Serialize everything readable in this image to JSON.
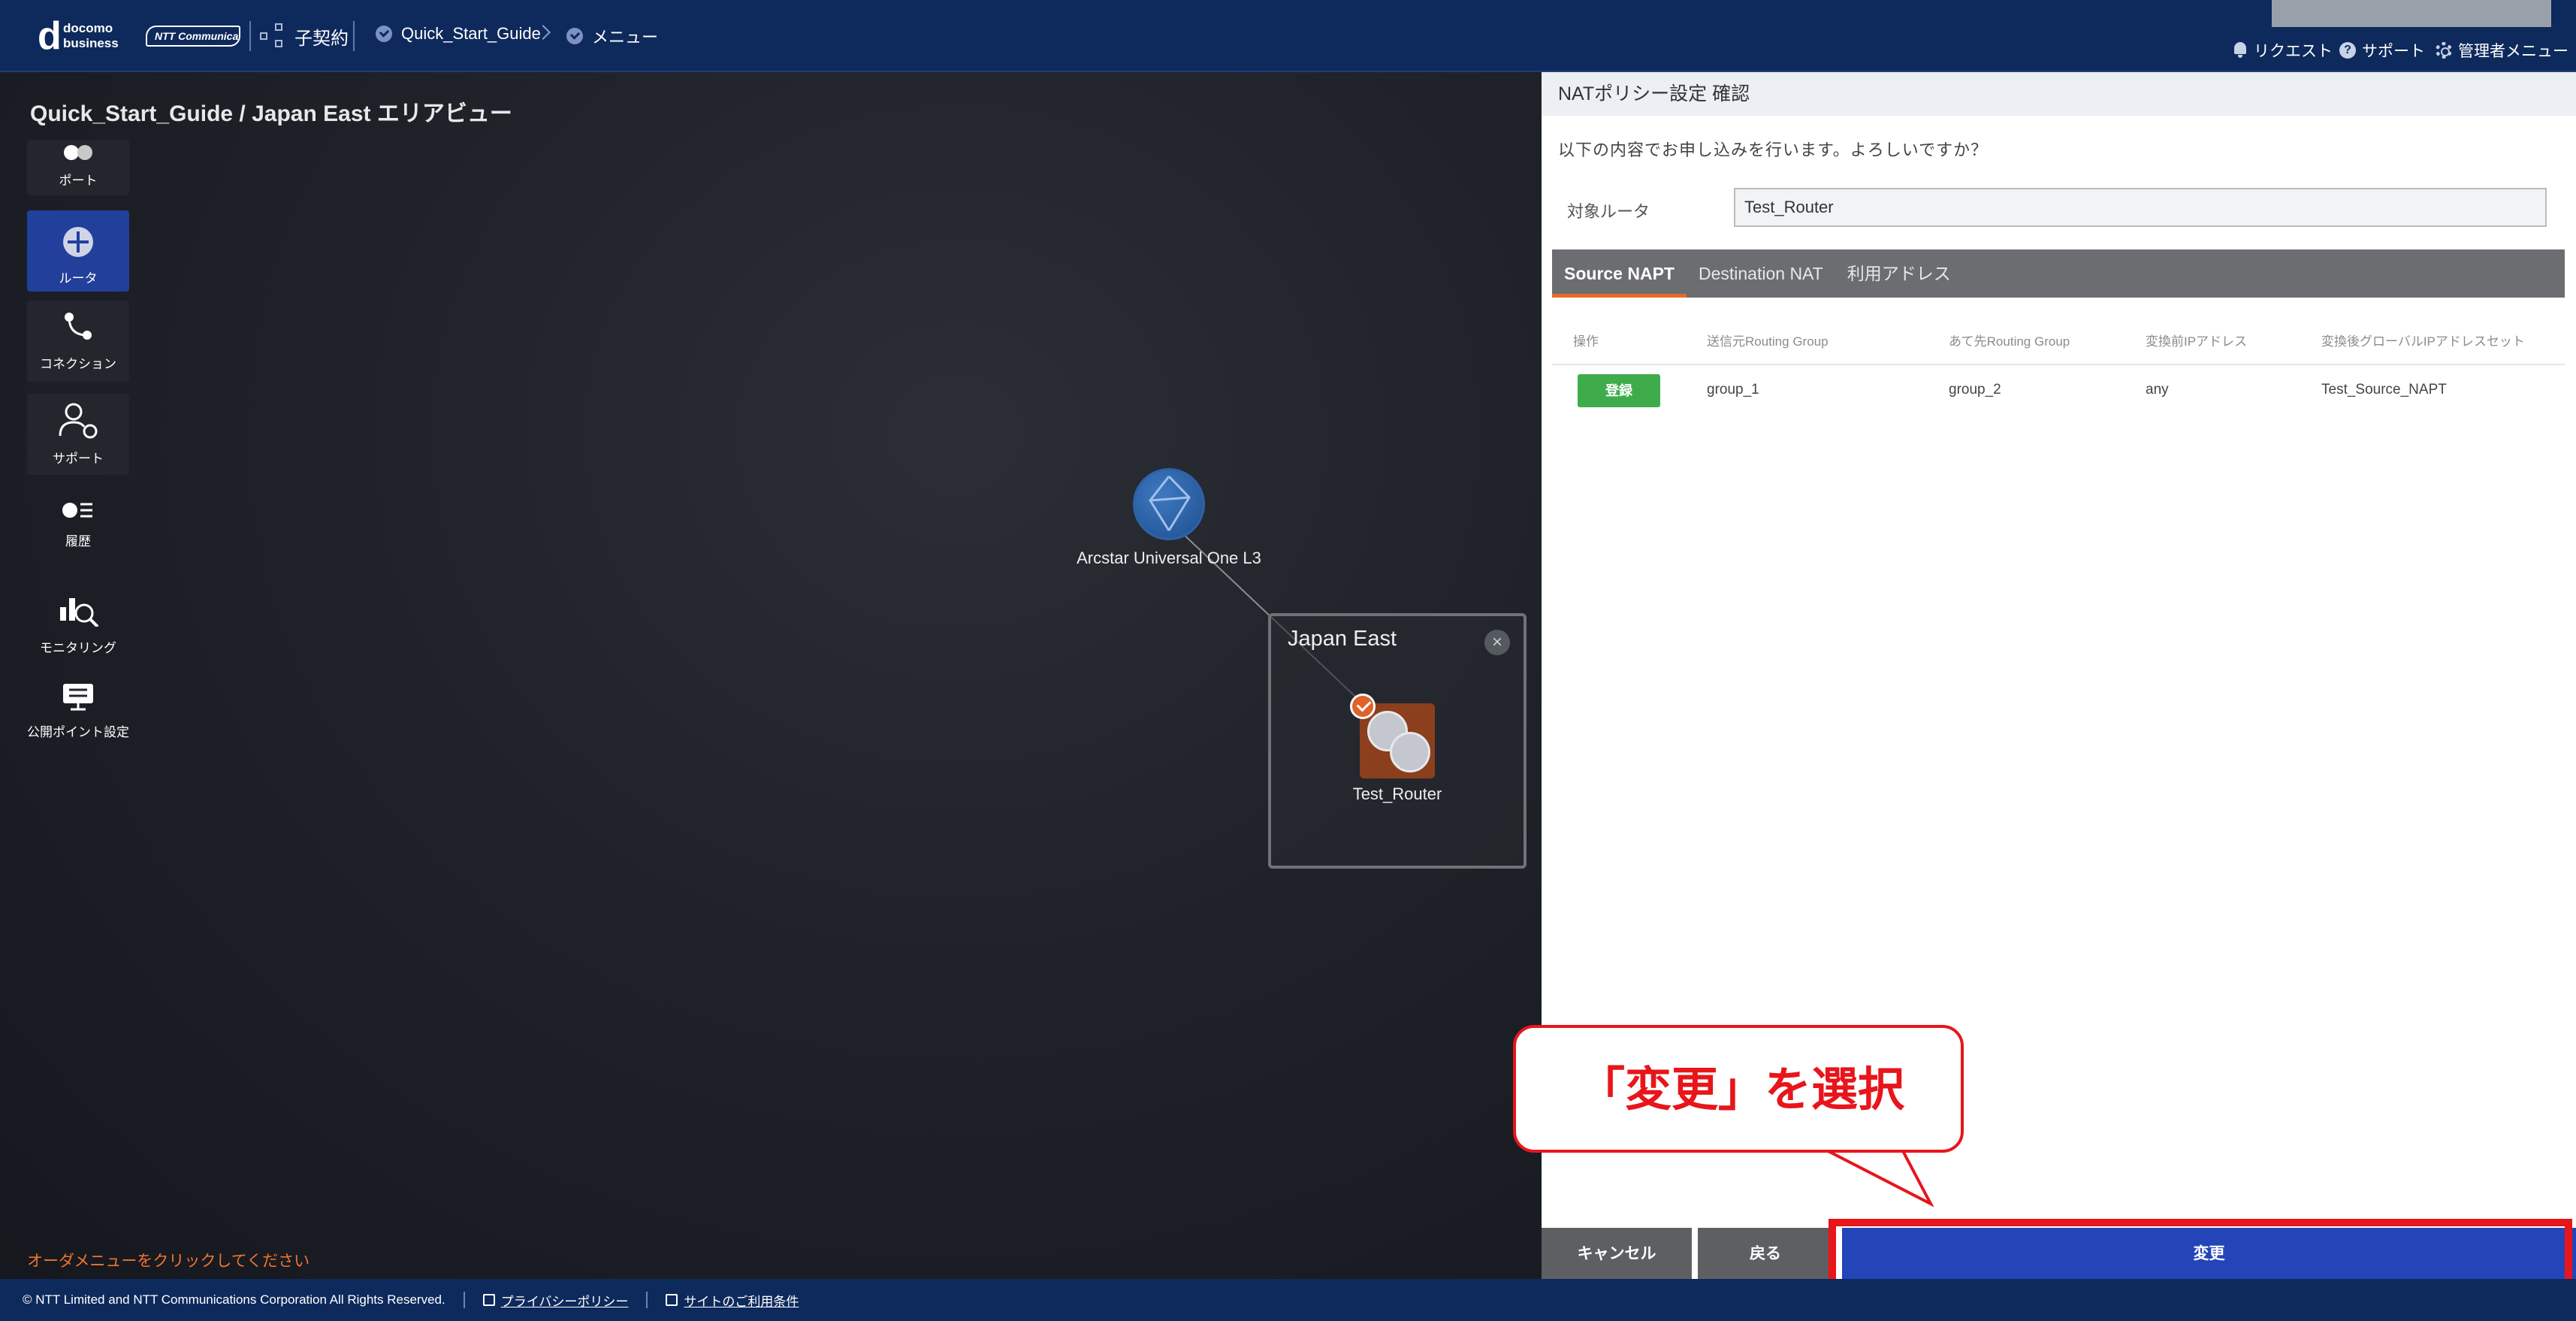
{
  "header": {
    "logo_d": "d",
    "logo_line1": "docomo",
    "logo_line2": "business",
    "ntt_logo": "NTT Communications",
    "sub_contract": "子契約",
    "breadcrumb": [
      "Quick_Start_Guide",
      "メニュー"
    ],
    "links": {
      "request": "リクエスト",
      "support": "サポート",
      "admin": "管理者メニュー"
    }
  },
  "canvas": {
    "title": "Quick_Start_Guide / Japan East エリアビュー",
    "sidebar": [
      {
        "label": "ポート",
        "icon": "port-icon"
      },
      {
        "label": "ルータ",
        "icon": "router-icon",
        "active": true
      },
      {
        "label": "コネクション",
        "icon": "connection-icon"
      },
      {
        "label": "サポート",
        "icon": "support-icon"
      },
      {
        "label": "履歴",
        "icon": "history-icon"
      },
      {
        "label": "モニタリング",
        "icon": "monitoring-icon"
      },
      {
        "label": "公開ポイント設定",
        "icon": "public-point-icon"
      }
    ],
    "cloud_label": "Arcstar Universal One L3",
    "region_title": "Japan East",
    "router_label": "Test_Router",
    "order_hint": "オーダメニューをクリックしてください"
  },
  "panel": {
    "title": "NATポリシー設定 確認",
    "confirm_message": "以下の内容でお申し込みを行います。よろしいですか？",
    "target_label": "対象ルータ",
    "target_value": "Test_Router",
    "tabs": [
      "Source NAPT",
      "Destination NAT",
      "利用アドレス"
    ],
    "table": {
      "headers": [
        "操作",
        "送信元Routing Group",
        "あて先Routing Group",
        "変換前IPアドレス",
        "変換後グローバルIPアドレスセット"
      ],
      "rows": [
        {
          "action": "登録",
          "src": "group_1",
          "dst": "group_2",
          "before": "any",
          "after": "Test_Source_NAPT"
        }
      ]
    },
    "buttons": {
      "cancel": "キャンセル",
      "back": "戻る",
      "change": "変更"
    }
  },
  "annotation": {
    "callout": "「変更」を選択",
    "color": "#e8151b"
  },
  "footer": {
    "copyright": "© NTT Limited and NTT Communications Corporation All Rights Reserved.",
    "privacy": "プライバシーポリシー",
    "terms": "サイトのご利用条件"
  }
}
